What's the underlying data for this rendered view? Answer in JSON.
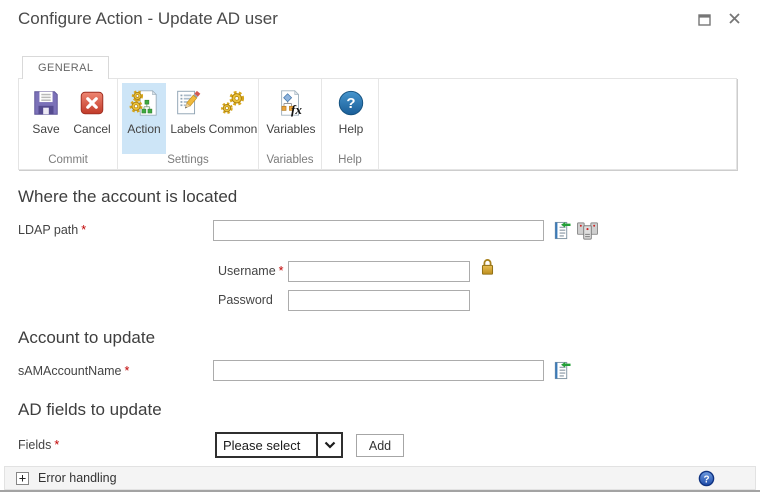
{
  "window": {
    "title": "Configure Action - Update AD user"
  },
  "tabs": {
    "general": "GENERAL"
  },
  "ribbon": {
    "groups": [
      {
        "label": "Commit",
        "buttons": [
          {
            "label": "Save"
          },
          {
            "label": "Cancel"
          }
        ]
      },
      {
        "label": "Settings",
        "buttons": [
          {
            "label": "Action",
            "active": true
          },
          {
            "label": "Labels"
          },
          {
            "label": "Common"
          }
        ]
      },
      {
        "label": "Variables",
        "buttons": [
          {
            "label": "Variables"
          }
        ]
      },
      {
        "label": "Help",
        "buttons": [
          {
            "label": "Help"
          }
        ]
      }
    ]
  },
  "form": {
    "required_marker": "*",
    "sections": {
      "location": {
        "title": "Where the account is located"
      },
      "account": {
        "title": "Account to update"
      },
      "fields": {
        "title": "AD fields to update"
      }
    },
    "ldap_path": {
      "label": "LDAP path",
      "value": "",
      "required": true
    },
    "username": {
      "label": "Username",
      "value": "",
      "required": true
    },
    "password": {
      "label": "Password",
      "value": "",
      "required": false
    },
    "sam_account_name": {
      "label": "sAMAccountName",
      "value": "",
      "required": true
    },
    "fields_select": {
      "label": "Fields",
      "selected_option": "Please select",
      "required": true
    },
    "add_button": {
      "label": "Add"
    }
  },
  "error_handling": {
    "label": "Error handling",
    "expand_glyph": "+"
  },
  "icons": [
    "maximize-icon",
    "close-icon",
    "save-icon",
    "cancel-icon",
    "action-icon",
    "labels-icon",
    "common-icon",
    "variables-icon",
    "help-icon",
    "insert-reference-icon",
    "ldap-picker-icon",
    "lock-icon",
    "chevron-down-icon",
    "expand-plus-icon",
    "error-help-icon"
  ],
  "colors": {
    "active_button_bg": "#cde5f7",
    "required_asterisk": "#c00000",
    "help_blue": "#2b77b3",
    "ribbon_border": "#e4e4e4",
    "input_border": "#acacac",
    "error_bar_bg": "#f4f4f4"
  }
}
